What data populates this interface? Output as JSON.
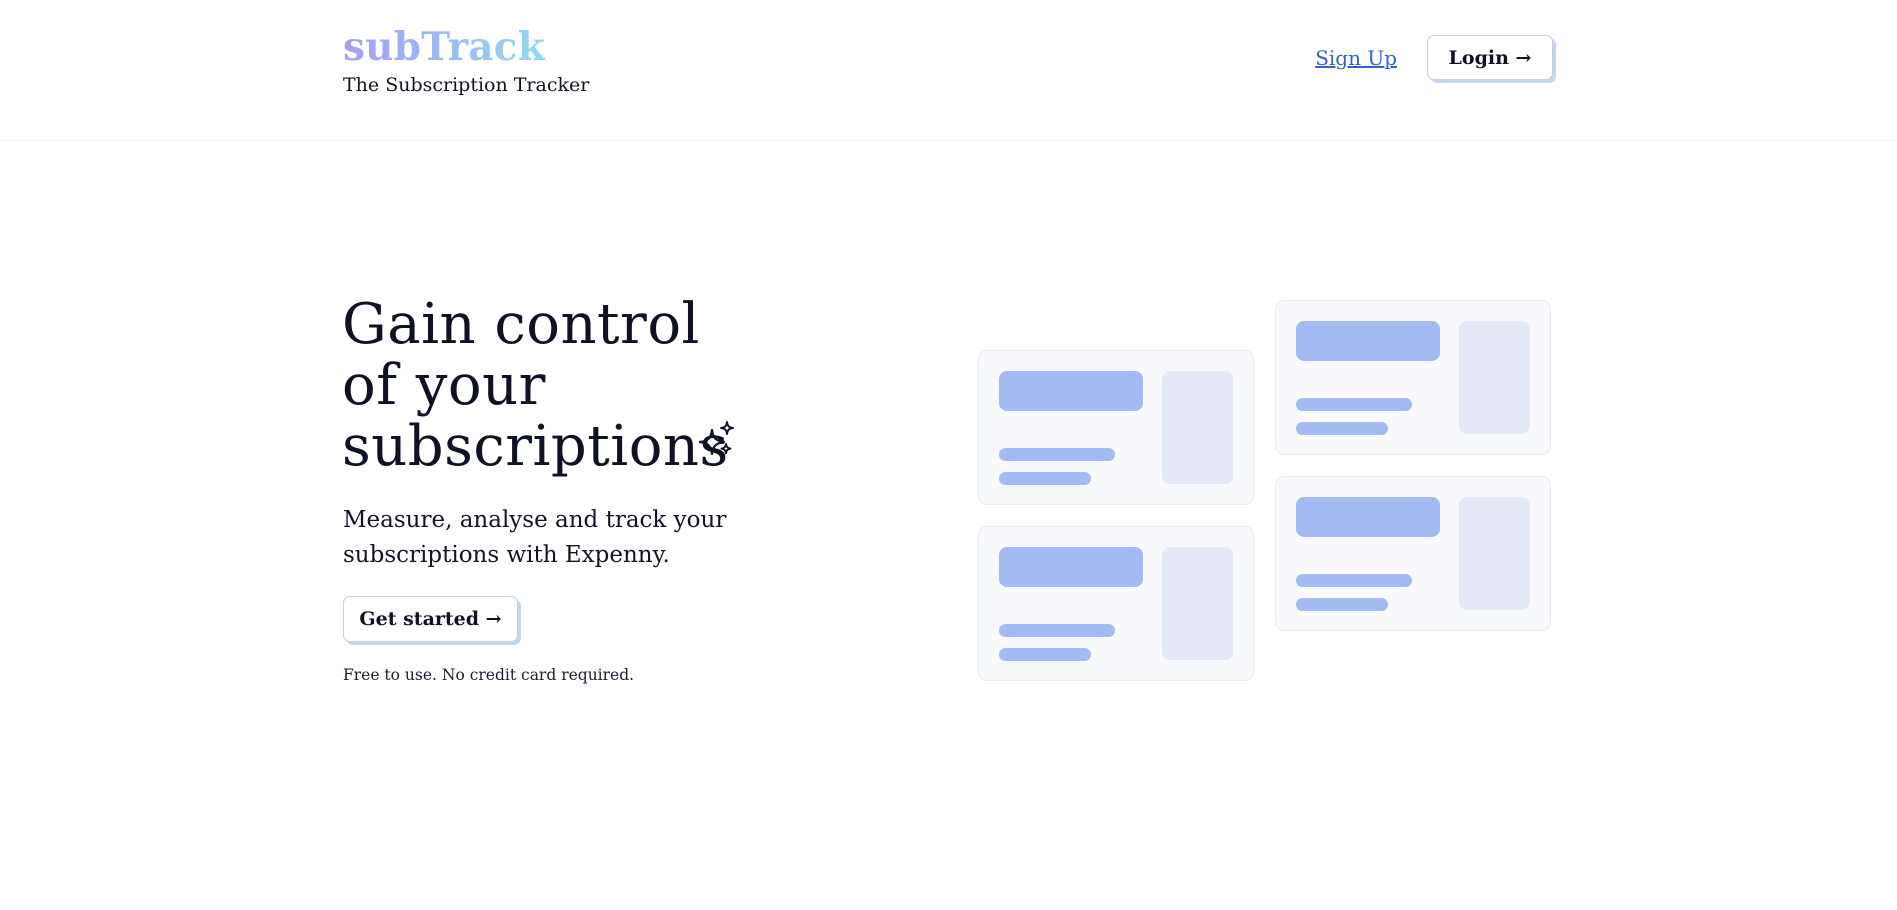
{
  "header": {
    "logo_text": "subTrack",
    "tagline": "The Subscription Tracker",
    "signup_label": "Sign Up",
    "login_label": "Login →"
  },
  "hero": {
    "title_line1": "Gain control",
    "title_line2": "of your",
    "title_line3": "subscriptions",
    "subtitle": "Measure, analyse and track your subscriptions with Expenny.",
    "cta_label": "Get started →",
    "note": "Free to use. No credit card required."
  },
  "icons": {
    "sparkle": "sparkles-icon"
  },
  "colors": {
    "logo_gradient": [
      "#a5a0f0",
      "#9cc0f2",
      "#8ce8ea"
    ],
    "link": "#2d63d6",
    "card_accent": "#a3baf2",
    "card_side": "#e3e9f7",
    "card_bg": "#f8f9fc",
    "button_shadow": "#c4d6ec"
  }
}
